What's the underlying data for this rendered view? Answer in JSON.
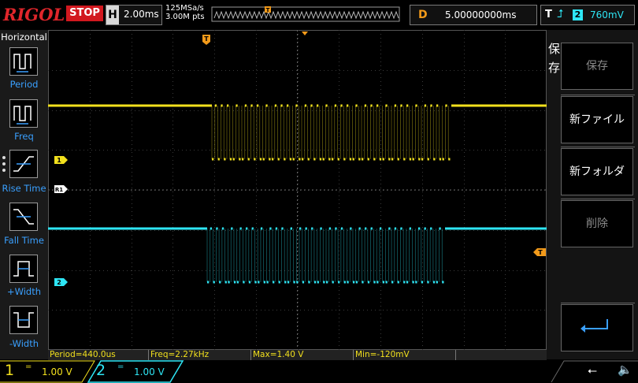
{
  "topbar": {
    "logo": "RIGOL",
    "run_state": "STOP",
    "horizontal_label": "H",
    "timebase": "2.00ms",
    "sample_rate": "125MSa/s",
    "memory_depth": "3.00M pts",
    "delay_label": "D",
    "delay_value": "5.00000000ms",
    "trigger_label": "T",
    "trigger_source": "2",
    "trigger_level": "760mV"
  },
  "left_menu": {
    "title": "Horizontal",
    "items": [
      {
        "label": "Period",
        "icon": "period-icon"
      },
      {
        "label": "Freq",
        "icon": "frequency-icon"
      },
      {
        "label": "Rise Time",
        "icon": "rise-time-icon"
      },
      {
        "label": "Fall Time",
        "icon": "fall-time-icon"
      },
      {
        "label": "+Width",
        "icon": "positive-width-icon"
      },
      {
        "label": "-Width",
        "icon": "negative-width-icon"
      }
    ]
  },
  "right_menu": {
    "title_line1": "保",
    "title_line2": "存",
    "buttons": [
      {
        "label": "保存",
        "enabled": false
      },
      {
        "label": "新ファイル",
        "enabled": true
      },
      {
        "label": "新フォルダ",
        "enabled": true
      },
      {
        "label": "削除",
        "enabled": false
      },
      {
        "label": "",
        "icon": "enter-return-icon",
        "enabled": true
      }
    ]
  },
  "markers": {
    "ch1": "1",
    "ref": "R1",
    "ch2": "2",
    "trigger_pos": "T",
    "trigger_level": "T"
  },
  "measurements": [
    {
      "label": "Period=440.0us"
    },
    {
      "label": "Freq=2.27kHz"
    },
    {
      "label": "Max=1.40 V"
    },
    {
      "label": "Min=-120mV"
    }
  ],
  "channels": [
    {
      "number": "1",
      "coupling": "=",
      "scale": "1.00 V",
      "color": "#f2e01d"
    },
    {
      "number": "2",
      "coupling": "=",
      "scale": "1.00 V",
      "color": "#2ee6f5"
    }
  ],
  "colors": {
    "ch1": "#f2e01d",
    "ch2": "#2ee6f5",
    "trigger": "#f29a1a",
    "accent": "#3aa0ff"
  }
}
